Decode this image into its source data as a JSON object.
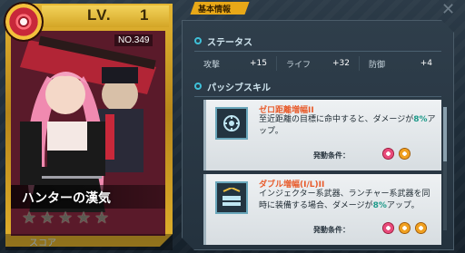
{
  "card": {
    "level_label": "LV.",
    "level_value": "1",
    "number": "NO.349",
    "name": "ハンターの漢気",
    "stars": [
      "★",
      "★",
      "★",
      "★",
      "★"
    ],
    "score_label": "スコア"
  },
  "tab": {
    "label": "基本情報"
  },
  "status": {
    "title": "ステータス",
    "stats": [
      {
        "name": "攻撃",
        "value": "+15"
      },
      {
        "name": "ライフ",
        "value": "+32"
      },
      {
        "name": "防御",
        "value": "+4"
      }
    ]
  },
  "passive": {
    "title": "パッシブスキル",
    "skills": [
      {
        "name": "ゼロ距離増幅II",
        "desc_before": "至近距離の目標に命中すると、ダメージが",
        "desc_highlight": "8%",
        "desc_after": "アップ。",
        "cond_label": "発動条件：",
        "icon": "target-hit-icon"
      },
      {
        "name": "ダブル増幅(I/L)II",
        "desc_before": "インジェクター系武器、ランチャー系武器を同時に装備する場合、ダメージが",
        "desc_highlight": "8%",
        "desc_after": "アップ。",
        "cond_label": "発動条件：",
        "icon": "double-weapon-icon"
      }
    ]
  },
  "colors": {
    "accent": "#3fc0d8",
    "highlight": "#1f9a8a",
    "skill_name": "#e85a2a",
    "gold": "#e4b632"
  }
}
